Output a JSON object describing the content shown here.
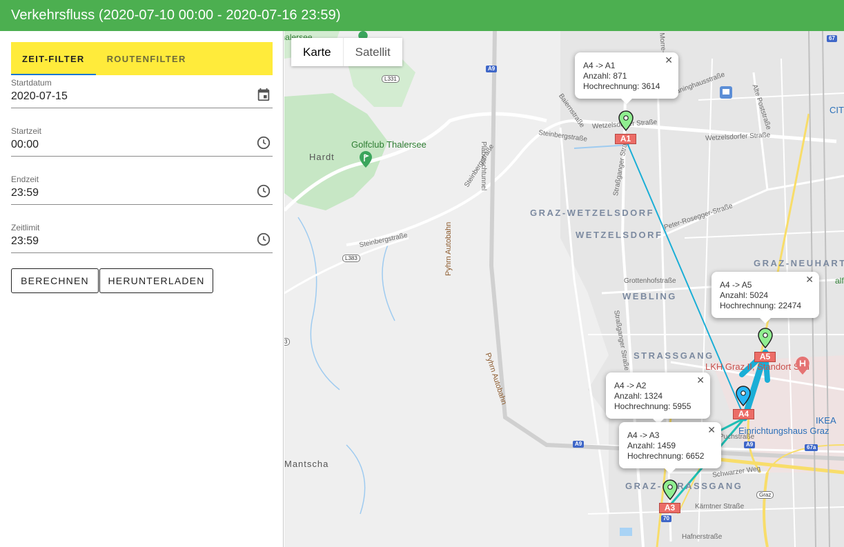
{
  "header": {
    "title": "Verkehrsfluss (2020-07-10 00:00 - 2020-07-16 23:59)"
  },
  "tabs": [
    {
      "label": "ZEIT-FILTER",
      "active": true
    },
    {
      "label": "ROUTENFILTER",
      "active": false
    }
  ],
  "form": {
    "start_date": {
      "label": "Startdatum",
      "value": "2020-07-15",
      "icon": "calendar-icon"
    },
    "start_time": {
      "label": "Startzeit",
      "value": "00:00",
      "icon": "clock-icon"
    },
    "end_time": {
      "label": "Endzeit",
      "value": "23:59",
      "icon": "clock-icon"
    },
    "time_limit": {
      "label": "Zeitlimit",
      "value": "23:59",
      "icon": "clock-icon"
    }
  },
  "buttons": {
    "calculate": "BERECHNEN",
    "download": "HERUNTERLADEN"
  },
  "map": {
    "type_control": {
      "map": "Karte",
      "satellite": "Satellit"
    },
    "markers": [
      {
        "id": "A1",
        "color": "#90ee90"
      },
      {
        "id": "A5",
        "color": "#90ee90"
      },
      {
        "id": "A4",
        "color": "#29b6f6"
      },
      {
        "id": "A3",
        "color": "#90ee90"
      }
    ],
    "popups": [
      {
        "route": "A4 -> A1",
        "count": "Anzahl: 871",
        "projection": "Hochrechnung: 3614"
      },
      {
        "route": "A4 -> A5",
        "count": "Anzahl: 5024",
        "projection": "Hochrechnung: 22474"
      },
      {
        "route": "A4 -> A2",
        "count": "Anzahl: 1324",
        "projection": "Hochrechnung: 5955"
      },
      {
        "route": "A4 -> A3",
        "count": "Anzahl: 1459",
        "projection": "Hochrechnung: 6652"
      }
    ],
    "labels": {
      "graz_wetzelsdorf": "GRAZ-WETZELSDORF",
      "wetzelsdorf": "WETZELSDORF",
      "graz_neuhart": "GRAZ-NEUHART",
      "webling": "WEBLING",
      "strassgang": "STRASSGANG",
      "graz_strassgang": "GRAZ-STRASSGANG",
      "golfclub": "Golfclub Thalersee",
      "hardt": "Hardt",
      "mantscha": "Mantscha",
      "lkh": "LKH Graz II, Standort Süd",
      "ikea": "IKEA",
      "ikea_sub": "Einrichtungshaus Graz",
      "city": "CITY",
      "pyhrn1": "Pyhrn Autobahn",
      "pyhrn2": "Pyhrn Autobahn",
      "plabutsch": "Plabutschtunnel",
      "wetzelsdorfer1": "Wetzelsdorfer Straße",
      "wetzelsdorfer2": "Wetzelsdorfer Straße",
      "steinberg1": "Steinbergstraße",
      "steinberg2": "Steinbergstraße",
      "steinberg3": "Steinbergstraße",
      "strassganger1": "Straßganger Straße",
      "strassganger2": "Straßganger Straße",
      "rosegger": "Peter-Rosegger-Straße",
      "grottenhof": "Grottenhofstraße",
      "alte_post": "Alte Poststraße",
      "schwarzer": "Schwarzer Weg",
      "hafner": "Hafnerstraße",
      "baiern": "Baiernstraße",
      "kaerntner": "Kärntner Straße",
      "a9_a": "A9",
      "a9_b": "A9",
      "a9_c": "A9",
      "l331": "L331",
      "l383": "L383",
      "s67": "67",
      "s67a": "67a",
      "s70": "70",
      "graz_sh": "Graz",
      "gaenning": "Gräninghausstraße",
      "morre": "Morre-Straße",
      "puchstr": "Puchstraße",
      "zahl3": "3",
      "alfried": "alfried",
      "golf_top": "Golfclub Thalersee"
    }
  }
}
